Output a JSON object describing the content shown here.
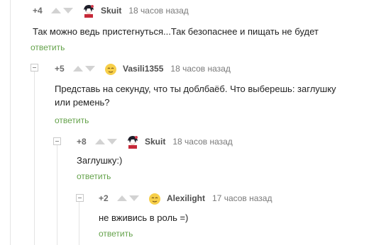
{
  "comments": [
    {
      "rating": "+4",
      "username": "Skuit",
      "time": "18 часов назад",
      "avatar_icon": "anime-avatar-icon",
      "text_lines": [
        "Так можно ведь пристегнуться...Так безопаснее и пищать не будет"
      ],
      "reply_label": "ответить"
    },
    {
      "rating": "+5",
      "username": "Vasili1355",
      "time": "18 часов назад",
      "avatar_icon": "emoji-avatar-icon",
      "text_lines": [
        "Представь на секунду, что ты доблбаёб. Что выберешь: заглушку",
        "или ремень?"
      ],
      "reply_label": "ответить"
    },
    {
      "rating": "+8",
      "username": "Skuit",
      "time": "18 часов назад",
      "avatar_icon": "anime-avatar-icon",
      "text_lines": [
        "Заглушку:)"
      ],
      "reply_label": "ответить"
    },
    {
      "rating": "+2",
      "username": "Alexilight",
      "time": "17 часов назад",
      "avatar_icon": "emoji-avatar-icon",
      "text_lines": [
        "не вживись в роль =)"
      ],
      "reply_label": "ответить"
    }
  ],
  "colors": {
    "reply_link": "#64a24a",
    "vote_arrow": "#d2d2d2",
    "thread_line": "#e4e4e4"
  }
}
